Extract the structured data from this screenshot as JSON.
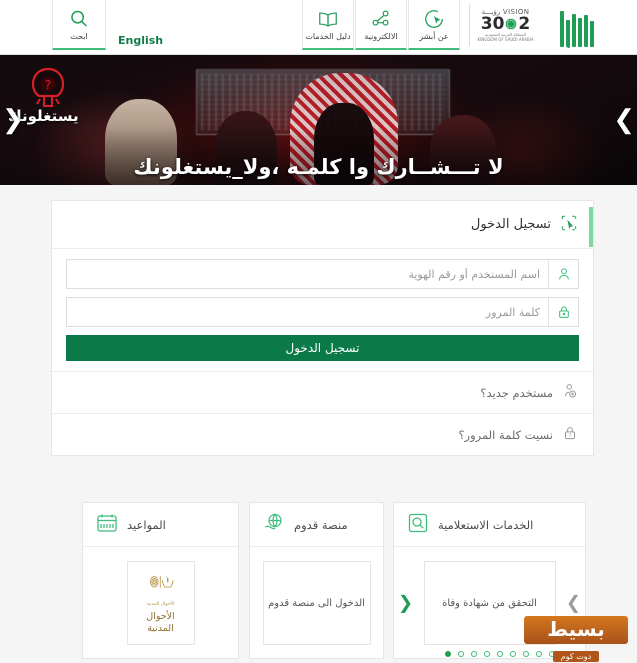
{
  "header": {
    "search_button": {
      "label": "ابحث",
      "icon": "search-icon"
    },
    "english_link": "English",
    "nav_items": [
      {
        "label": "عن أبشر",
        "icon": "cursor-circle-icon"
      },
      {
        "label": "الالكترونية",
        "icon": "share-network-icon"
      },
      {
        "label": "دليل الخدمات",
        "icon": "book-icon"
      }
    ],
    "vision_logo": {
      "top": "VISION",
      "top_ar": "رؤيـــة",
      "year": "2030",
      "sub_ar": "المملكة العربية السعودية",
      "sub_en": "KINGDOM OF SAUDI ARABIA"
    },
    "brand_logo": "absher-bars-logo"
  },
  "banner": {
    "campaign_word": "يستغلونك",
    "headline": "لا تـــشــارك وا كلمـه ،ولا_يستغلونك",
    "prev_arrow": "❮",
    "next_arrow": "❯",
    "hacker_icon": "hooded-figure-question-icon"
  },
  "login": {
    "title": "تسجيل الدخول",
    "title_icon": "login-cursor-icon",
    "username": {
      "value": "",
      "placeholder": "اسم المستخدم أو رقم الهوية",
      "icon": "user-icon"
    },
    "password": {
      "value": "",
      "placeholder": "كلمة المرور",
      "icon": "lock-icon"
    },
    "submit_label": "تسجيل الدخول",
    "new_user": {
      "label": "مستخدم جديد؟",
      "icon": "user-add-icon"
    },
    "forgot_password": {
      "label": "نسيت كلمة المرور؟",
      "icon": "lock-question-icon"
    }
  },
  "service_cards": [
    {
      "id": "info",
      "title": "الخدمات الاستعلامية",
      "icon": "magnifier-box-icon",
      "tile_label": "التحقق من شهادة وفاة",
      "prev_arrow": "❮",
      "next_arrow": "❯"
    },
    {
      "id": "qudum",
      "title": "منصة قدوم",
      "icon": "globe-hand-icon",
      "tile_label": "الدخول الى منصة قدوم"
    },
    {
      "id": "appointments",
      "title": "المواعيد",
      "icon": "calendar-icon",
      "tile_label": "الأحوال المدنية",
      "tile_emblem_label": "الأحوال المدنية"
    }
  ],
  "carousel": {
    "total_dots": 11,
    "active_index": 10
  },
  "watermark": {
    "main": "بسيط",
    "sub": "دوت كوم"
  },
  "colors": {
    "brand_green": "#1f9d55",
    "button_green": "#0b7a48",
    "accent_light_green": "#7ddc9b",
    "banner_dark": "#120a0d",
    "watermark_orange": "#c06a1e",
    "emblem_gold": "#b79446"
  }
}
